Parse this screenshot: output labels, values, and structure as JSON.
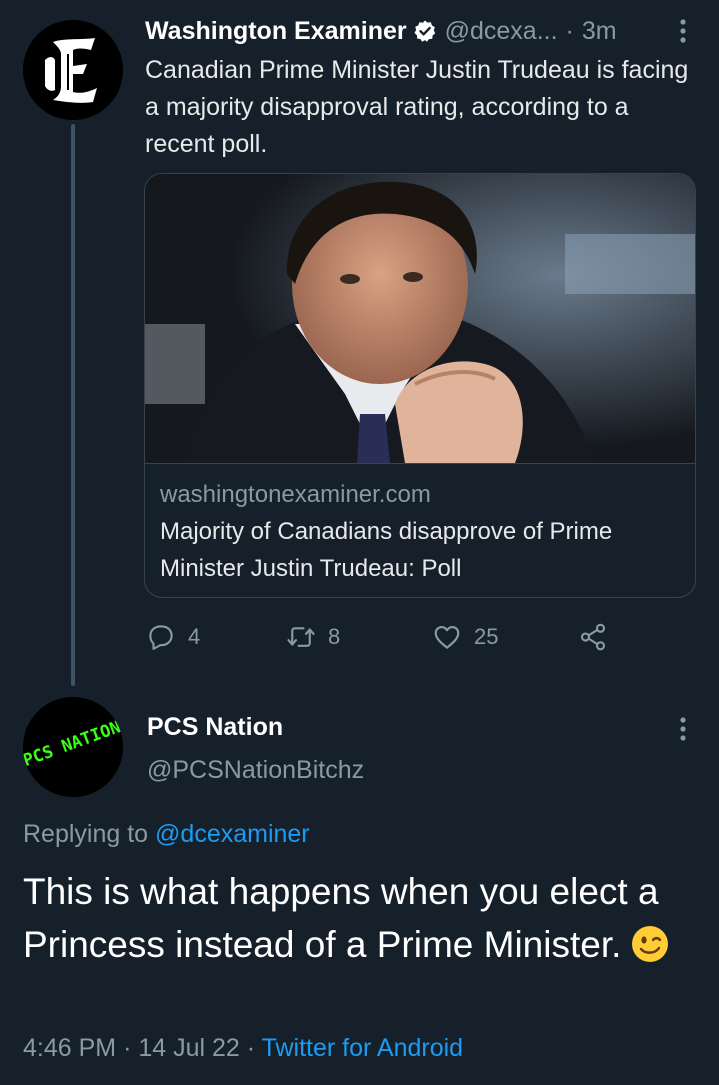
{
  "tweet1": {
    "name": "Washington Examiner",
    "handle": "@dcexa...",
    "dot": "·",
    "time": "3m",
    "text": "Canadian Prime Minister Justin Trudeau is facing a majority disapproval rating, according to a recent poll.",
    "card": {
      "domain": "washingtonexaminer.com",
      "title": "Majority of Canadians disapprove of Prime Minister Justin Trudeau: Poll"
    },
    "actions": {
      "reply_count": "4",
      "retweet_count": "8",
      "like_count": "25"
    }
  },
  "tweet2": {
    "name": "PCS Nation",
    "handle": "@PCSNationBitchz",
    "avatar_text": "PCS NATION",
    "replying_prefix": "Replying to",
    "replying_handle": "@dcexaminer",
    "text": "This is what happens when you elect a Princess instead of a Prime Minister.",
    "emoji": "winking-face",
    "time": "4:46 PM",
    "sep1": "·",
    "date": "14 Jul 22",
    "sep2": "·",
    "source": "Twitter for Android"
  },
  "colors": {
    "background": "#15202b",
    "muted": "#8b98a5",
    "link": "#1d9bf0",
    "verified": "#ffffff",
    "pcs_green": "#39ff14"
  }
}
